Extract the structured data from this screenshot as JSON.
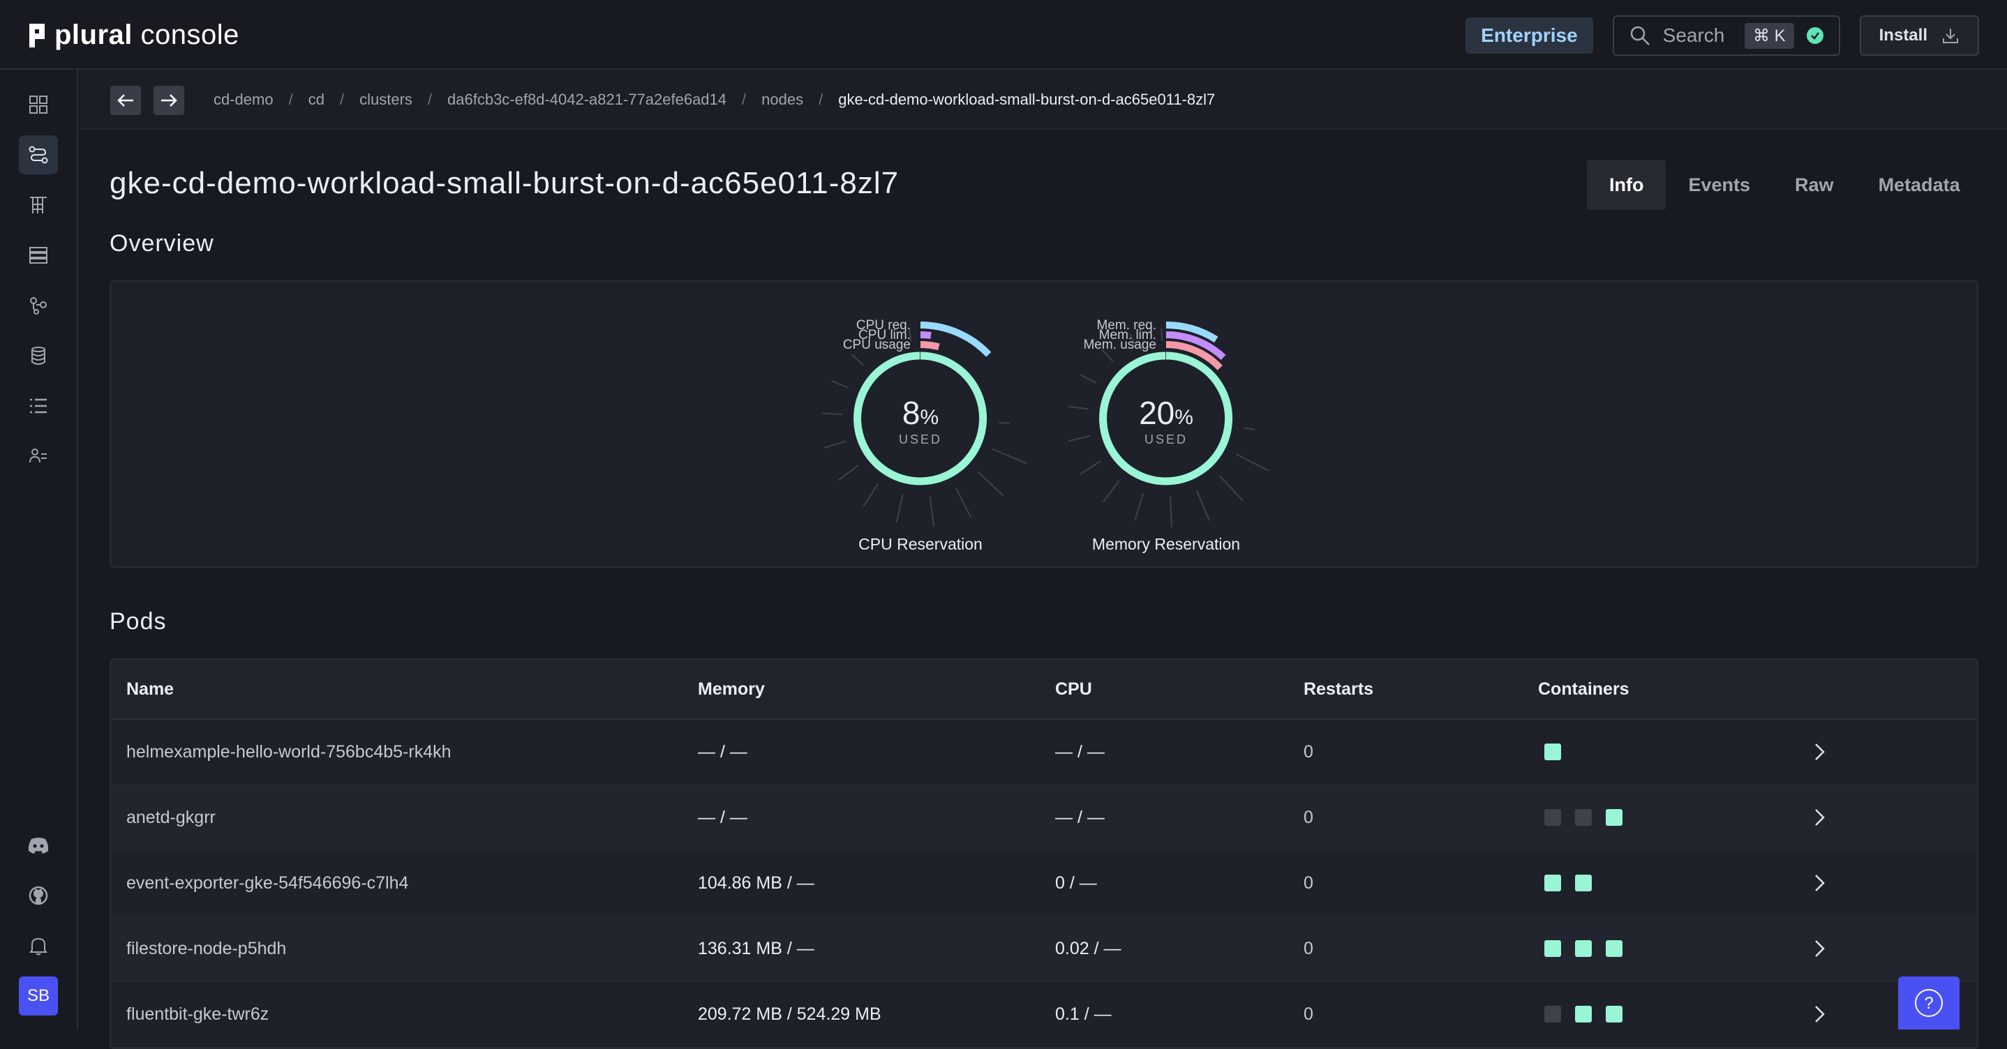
{
  "header": {
    "logo_brand": "plural",
    "logo_product": "console",
    "enterprise_label": "Enterprise",
    "search_label": "Search",
    "search_shortcut": "⌘ K",
    "install_label": "Install"
  },
  "sidebar": {
    "avatar_initials": "SB",
    "items": [
      {
        "icon": "grid-icon"
      },
      {
        "icon": "continuous-deployment-icon"
      },
      {
        "icon": "stack-icon"
      },
      {
        "icon": "server-icon"
      },
      {
        "icon": "git-branch-icon"
      },
      {
        "icon": "database-icon"
      },
      {
        "icon": "list-icon"
      },
      {
        "icon": "people-icon"
      },
      {
        "icon": "discord-icon"
      },
      {
        "icon": "github-icon"
      },
      {
        "icon": "bell-icon"
      }
    ]
  },
  "breadcrumb": [
    "cd-demo",
    "cd",
    "clusters",
    "da6fcb3c-ef8d-4042-a821-77a2efe6ad14",
    "nodes",
    "gke-cd-demo-workload-small-burst-on-d-ac65e011-8zl7"
  ],
  "page": {
    "title": "gke-cd-demo-workload-small-burst-on-d-ac65e011-8zl7",
    "tabs": [
      "Info",
      "Events",
      "Raw",
      "Metadata"
    ],
    "active_tab": "Info",
    "overview_title": "Overview",
    "pods_title": "Pods"
  },
  "gauges": [
    {
      "title": "CPU Reservation",
      "value": "8",
      "unit": "%",
      "caption": "USED",
      "fraction": 0.08,
      "rings": [
        {
          "label": "CPU req.",
          "value": 0.13,
          "color": "#99daff"
        },
        {
          "label": "CPU lim.",
          "value": 0.02,
          "color": "#c28dfa"
        },
        {
          "label": "CPU usage",
          "value": 0.04,
          "color": "#f599a8"
        }
      ],
      "main_color": "#99f5d5"
    },
    {
      "title": "Memory Reservation",
      "value": "20",
      "unit": "%",
      "caption": "USED",
      "fraction": 0.2,
      "rings": [
        {
          "label": "Mem. req.",
          "value": 0.09,
          "color": "#99daff"
        },
        {
          "label": "Mem. lim.",
          "value": 0.12,
          "color": "#c28dfa"
        },
        {
          "label": "Mem. usage",
          "value": 0.13,
          "color": "#f599a8"
        }
      ],
      "main_color": "#99f5d5"
    }
  ],
  "pods": {
    "columns": [
      "Name",
      "Memory",
      "CPU",
      "Restarts",
      "Containers"
    ],
    "rows": [
      {
        "name": "helmexample-hello-world-756bc4b5-rk4kh",
        "memory": "— / —",
        "cpu": "— / —",
        "restarts": "0",
        "containers": [
          "on"
        ]
      },
      {
        "name": "anetd-gkgrr",
        "memory": "— / —",
        "cpu": "— / —",
        "restarts": "0",
        "containers": [
          "off",
          "off",
          "on"
        ]
      },
      {
        "name": "event-exporter-gke-54f546696-c7lh4",
        "memory": "104.86 MB / —",
        "cpu": "0 / —",
        "restarts": "0",
        "containers": [
          "on",
          "on"
        ]
      },
      {
        "name": "filestore-node-p5hdh",
        "memory": "136.31 MB / —",
        "cpu": "0.02 / —",
        "restarts": "0",
        "containers": [
          "on",
          "on",
          "on"
        ]
      },
      {
        "name": "fluentbit-gke-twr6z",
        "memory": "209.72 MB / 524.29 MB",
        "cpu": "0.1 / —",
        "restarts": "0",
        "containers": [
          "off",
          "on",
          "on"
        ]
      }
    ]
  },
  "colors": {
    "background": "#171a21",
    "accent": "#4a51f2",
    "container_ready": "#99f5d5",
    "container_idle": "#3d424d"
  }
}
